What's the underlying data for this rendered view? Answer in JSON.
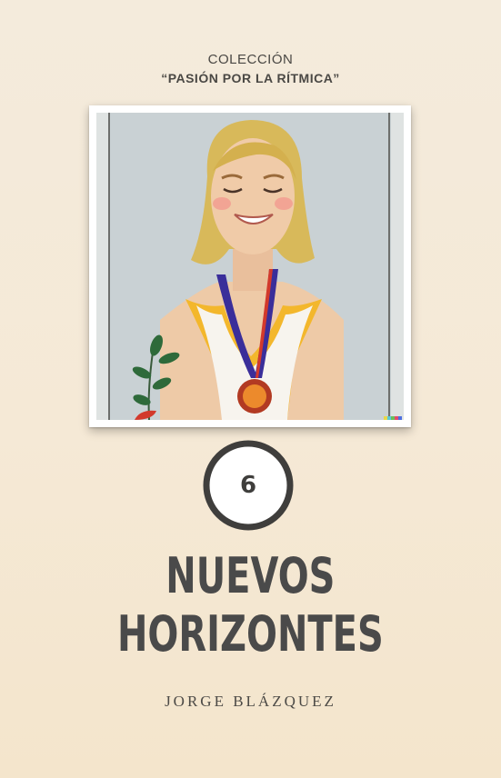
{
  "cover": {
    "collection_label": "COLECCIÓN",
    "collection_name": "“PASIÓN POR LA RÍTMICA”",
    "volume_number": "6",
    "title_line1": "NUEVOS",
    "title_line2": "HORIZONTES",
    "author": "JORGE BLÁZQUEZ"
  },
  "illustration": {
    "subject": "smiling-blonde-gymnast-with-medal",
    "colors": {
      "background": "#c6cfd3",
      "hair": "#d9bb5c",
      "skin": "#efc9a6",
      "leotard_trim": "#f1b62a",
      "ribbon_blue": "#3c2f9c",
      "ribbon_red": "#d2392c",
      "medal": "#e07b2a",
      "leaves": "#2e6a3a"
    }
  },
  "colors": {
    "page_background": "#f4ebdc",
    "text_dark": "#4a4a4a"
  }
}
